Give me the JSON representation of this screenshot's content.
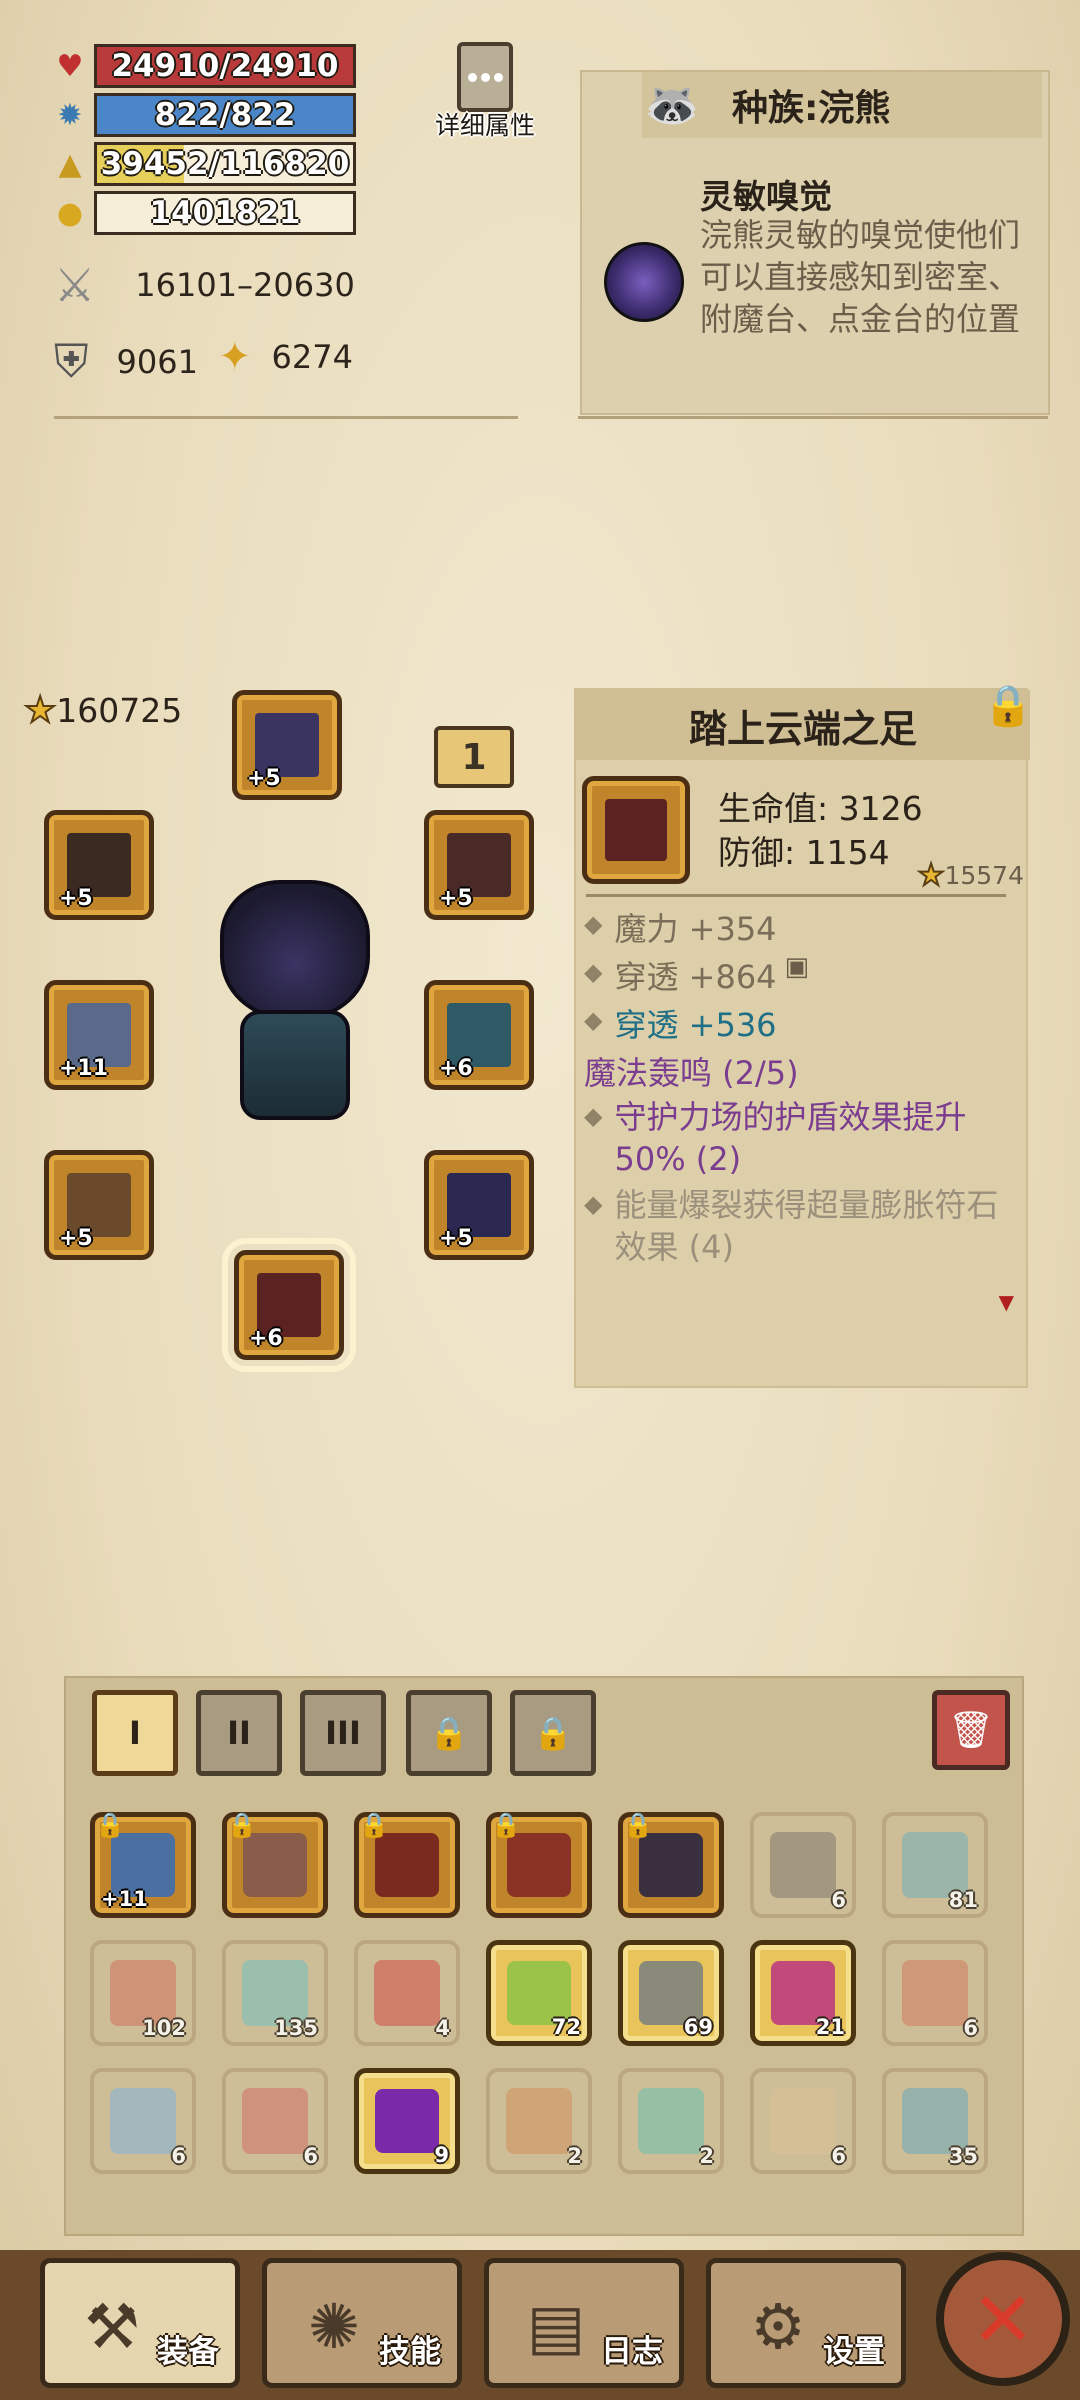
{
  "stats": {
    "hp": "24910/24910",
    "mp": "822/822",
    "xp": "39452/116820",
    "gold": "1401821",
    "hp_fill": 1.0,
    "mp_fill": 1.0,
    "xp_fill": 0.338,
    "attack": "16101–20630",
    "defense": "9061",
    "magic": "6274"
  },
  "detail_button": {
    "label": "详细属性"
  },
  "race": {
    "title": "种族:浣熊",
    "skill_title": "灵敏嗅觉",
    "skill_desc": "浣熊灵敏的嗅觉使他们可以直接感知到密室、附魔台、点金台的位置"
  },
  "equipment": {
    "total_score": "160725",
    "tier_badge": "1",
    "slots": [
      {
        "id": "helmet",
        "level": "+5"
      },
      {
        "id": "amulet",
        "level": "+5"
      },
      {
        "id": "cape",
        "level": "+5"
      },
      {
        "id": "weapon",
        "level": "+11"
      },
      {
        "id": "shoulder",
        "level": "+6"
      },
      {
        "id": "gloves",
        "level": "+5"
      },
      {
        "id": "armor",
        "level": "+5"
      },
      {
        "id": "boots",
        "level": "+6"
      }
    ]
  },
  "item": {
    "name": "踏上云端之足",
    "hp_line": "生命值: 3126",
    "def_line": "防御: 1154",
    "score": "15574",
    "attrs": [
      {
        "text": "魔力 +354",
        "color": "#7a6e58"
      },
      {
        "text": "穿透 +864",
        "color": "#7a6e58"
      },
      {
        "text": "穿透 +536",
        "color": "#1f6f86"
      },
      {
        "text": "魔法轰鸣 (2/5)",
        "color": "#7a3d8f"
      },
      {
        "text": "守护力场的护盾效果提升50% (2)",
        "color": "#7a3d8f"
      },
      {
        "text": "能量爆裂获得超量膨胀符石效果 (4)",
        "color": "#9a907c"
      }
    ]
  },
  "inventory": {
    "tabs": [
      "I",
      "II",
      "III"
    ],
    "locked_tabs": 2,
    "rows": [
      [
        {
          "count": "",
          "level": "+11",
          "kind": "rarity",
          "locked": true,
          "color": "#4a6fa0"
        },
        {
          "count": "",
          "level": "",
          "kind": "rarity",
          "locked": true,
          "color": "#8a5d4a"
        },
        {
          "count": "",
          "level": "",
          "kind": "rarity",
          "locked": true,
          "color": "#7a2a1e"
        },
        {
          "count": "",
          "level": "",
          "kind": "rarity",
          "locked": true,
          "color": "#8a3324"
        },
        {
          "count": "",
          "level": "",
          "kind": "rarity",
          "locked": true,
          "color": "#3a2f3f"
        },
        {
          "count": "6",
          "level": "",
          "kind": "faded",
          "locked": false,
          "color": "#9a8e7a"
        },
        {
          "count": "81",
          "level": "",
          "kind": "faded",
          "locked": false,
          "color": "#8fb4b0"
        }
      ],
      [
        {
          "count": "102",
          "level": "",
          "kind": "faded",
          "locked": false,
          "color": "#d08a70"
        },
        {
          "count": "135",
          "level": "",
          "kind": "faded",
          "locked": false,
          "color": "#8fc0b4"
        },
        {
          "count": "4",
          "level": "",
          "kind": "faded",
          "locked": false,
          "color": "#d07060"
        },
        {
          "count": "72",
          "level": "",
          "kind": "gold",
          "locked": false,
          "color": "#9bc34a"
        },
        {
          "count": "69",
          "level": "",
          "kind": "gold",
          "locked": false,
          "color": "#8a8a7a"
        },
        {
          "count": "21",
          "level": "",
          "kind": "gold",
          "locked": false,
          "color": "#c24a7a"
        },
        {
          "count": "6",
          "level": "",
          "kind": "faded",
          "locked": false,
          "color": "#d09070"
        }
      ],
      [
        {
          "count": "6",
          "level": "",
          "kind": "faded",
          "locked": false,
          "color": "#9ab8c8"
        },
        {
          "count": "6",
          "level": "",
          "kind": "faded",
          "locked": false,
          "color": "#d08878"
        },
        {
          "count": "9",
          "level": "",
          "kind": "gold",
          "locked": false,
          "color": "#7a2aa8"
        },
        {
          "count": "2",
          "level": "",
          "kind": "faded",
          "locked": false,
          "color": "#d0a070"
        },
        {
          "count": "2",
          "level": "",
          "kind": "faded",
          "locked": false,
          "color": "#8ac0a8"
        },
        {
          "count": "6",
          "level": "",
          "kind": "faded",
          "locked": false,
          "color": "#d8c098"
        },
        {
          "count": "35",
          "level": "",
          "kind": "faded",
          "locked": false,
          "color": "#8ab0b0"
        }
      ]
    ]
  },
  "nav": {
    "equip": "装备",
    "skills": "技能",
    "log": "日志",
    "settings": "设置"
  },
  "colors": {
    "hp": "#b83a3a",
    "mp": "#4a86c8",
    "xp": "#e6cf5a",
    "gold_bar": "#f6eed8"
  }
}
